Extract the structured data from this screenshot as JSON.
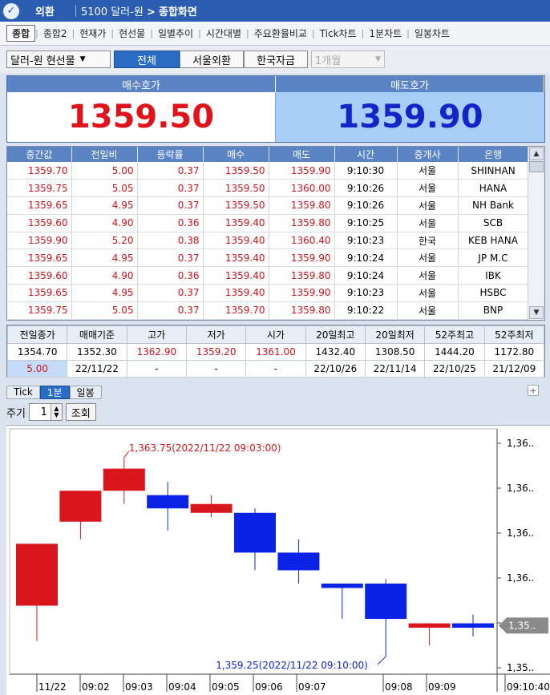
{
  "title_bar": {
    "menu": "외환",
    "screen_code": "5100 달러-원",
    "screen_name": "종합화면"
  },
  "tabs": [
    "종합",
    "종합2",
    "현재가",
    "현선물",
    "일별추이",
    "시간대별",
    "주요환율비교",
    "Tick차트",
    "1분차트",
    "일봉차트"
  ],
  "active_tab": "종합",
  "controls": {
    "instrument": "달러-원 현선물",
    "segments": [
      "전체",
      "서울외환",
      "한국자금"
    ],
    "active_segment": "전체",
    "period_combo": "1개월"
  },
  "quote": {
    "bid_label": "매수호가",
    "ask_label": "매도호가",
    "bid": "1359.50",
    "ask": "1359.90"
  },
  "trades": {
    "columns": [
      "중간값",
      "전일비",
      "등락률",
      "매수",
      "매도",
      "시간",
      "중개사",
      "은행"
    ],
    "rows": [
      [
        "1359.70",
        "5.00",
        "0.37",
        "1359.50",
        "1359.90",
        "9:10:30",
        "서울",
        "SHINHAN"
      ],
      [
        "1359.75",
        "5.05",
        "0.37",
        "1359.50",
        "1360.00",
        "9:10:26",
        "서울",
        "HANA"
      ],
      [
        "1359.65",
        "4.95",
        "0.37",
        "1359.50",
        "1359.80",
        "9:10:26",
        "서울",
        "NH Bank"
      ],
      [
        "1359.60",
        "4.90",
        "0.36",
        "1359.40",
        "1359.80",
        "9:10:25",
        "서울",
        "SCB"
      ],
      [
        "1359.90",
        "5.20",
        "0.38",
        "1359.40",
        "1360.40",
        "9:10:23",
        "한국",
        "KEB HANA"
      ],
      [
        "1359.65",
        "4.95",
        "0.37",
        "1359.40",
        "1359.90",
        "9:10:24",
        "서울",
        "JP M.C"
      ],
      [
        "1359.60",
        "4.90",
        "0.36",
        "1359.40",
        "1359.80",
        "9:10:24",
        "서울",
        "IBK"
      ],
      [
        "1359.65",
        "4.95",
        "0.37",
        "1359.40",
        "1359.90",
        "9:10:23",
        "서울",
        "HSBC"
      ],
      [
        "1359.75",
        "5.05",
        "0.37",
        "1359.70",
        "1359.80",
        "9:10:22",
        "서울",
        "BNP"
      ]
    ]
  },
  "summary": {
    "headers": [
      "전일종가",
      "매매기준",
      "고가",
      "저가",
      "시가",
      "20일최고",
      "20일최저",
      "52주최고",
      "52주최저"
    ],
    "values": [
      "1354.70",
      "1352.30",
      "1362.90",
      "1359.20",
      "1361.00",
      "1432.40",
      "1308.50",
      "1444.20",
      "1172.80"
    ],
    "sub": [
      "5.00",
      "22/11/22",
      "-",
      "-",
      "-",
      "22/10/26",
      "22/11/14",
      "22/10/25",
      "21/12/09"
    ]
  },
  "chart_tabs": [
    "Tick",
    "1분",
    "일봉"
  ],
  "active_chart_tab": "1분",
  "period": {
    "label": "주기",
    "value": "1",
    "query": "조회"
  },
  "chart_data": {
    "type": "candlestick",
    "x_labels": [
      "11/22",
      "09:02",
      "09:03",
      "09:04",
      "09:05",
      "09:06",
      "09:07",
      "09:08",
      "09:09",
      "09:10:40"
    ],
    "y_tick_labels": [
      "1,36..",
      "1,36..",
      "1,36..",
      "1,36..",
      "1,36..",
      "1,35.."
    ],
    "current_price_label": "1,35..",
    "candles": [
      {
        "open": 1360.4,
        "high": 1360.9,
        "low": 1359.6,
        "close": 1361.8,
        "up": true
      },
      {
        "open": 1362.3,
        "high": 1362.4,
        "low": 1361.9,
        "close": 1363.0,
        "up": true
      },
      {
        "open": 1363.0,
        "high": 1363.75,
        "low": 1362.7,
        "close": 1363.5,
        "up": true
      },
      {
        "open": 1362.9,
        "high": 1363.2,
        "low": 1362.1,
        "close": 1362.6,
        "up": false
      },
      {
        "open": 1362.7,
        "high": 1362.9,
        "low": 1362.4,
        "close": 1362.5,
        "up": true
      },
      {
        "open": 1362.5,
        "high": 1362.6,
        "low": 1361.2,
        "close": 1361.6,
        "up": false
      },
      {
        "open": 1361.6,
        "high": 1361.9,
        "low": 1360.9,
        "close": 1361.2,
        "up": false
      },
      {
        "open": 1360.9,
        "high": 1360.9,
        "low": 1360.1,
        "close": 1360.8,
        "up": false
      },
      {
        "open": 1360.9,
        "high": 1361.0,
        "low": 1359.25,
        "close": 1360.1,
        "up": false
      },
      {
        "open": 1359.9,
        "high": 1359.9,
        "low": 1359.5,
        "close": 1360.0,
        "up": true
      },
      {
        "open": 1360.0,
        "high": 1360.2,
        "low": 1359.7,
        "close": 1359.9,
        "up": false
      }
    ],
    "annotation_high": "1,363.75(2022/11/22 09:03:00)",
    "annotation_low": "1,359.25(2022/11/22 09:10:00)",
    "up_color": "#d9161c",
    "down_color": "#0b23e6"
  }
}
